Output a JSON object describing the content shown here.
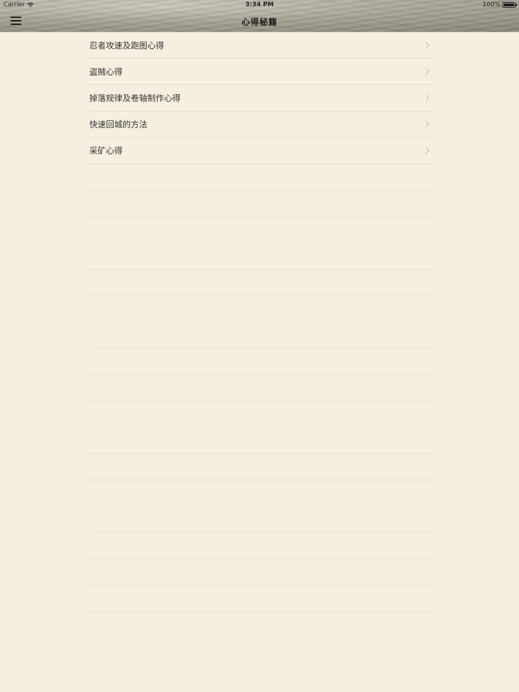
{
  "status_bar": {
    "carrier": "Carrier",
    "time": "3:34 PM",
    "battery": "100%"
  },
  "nav": {
    "title": "心得秘籍",
    "menu_icon": "hamburger-menu-icon"
  },
  "list": {
    "items": [
      {
        "label": "忍者攻速及跑图心得"
      },
      {
        "label": "盗贼心得"
      },
      {
        "label": "掉落规律及卷轴制作心得"
      },
      {
        "label": "快速回城的方法"
      },
      {
        "label": "采矿心得"
      }
    ],
    "chevron_icon": "chevron-right-icon"
  },
  "colors": {
    "background": "#f6eedf",
    "divider": "#e4dccb",
    "chevron": "#c6bfb1"
  }
}
